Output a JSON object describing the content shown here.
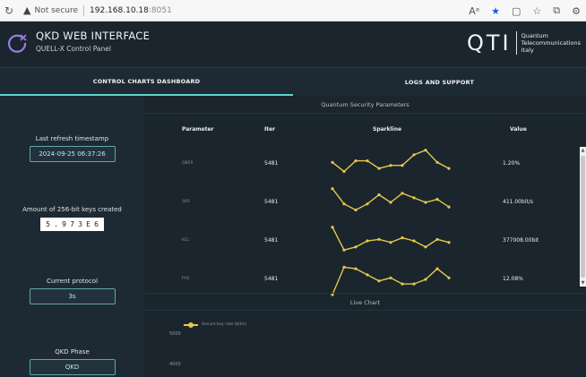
{
  "browser": {
    "reload_icon": "reload-icon",
    "warning_icon": "warning-icon",
    "security_label": "Not secure",
    "url": "192.168.10.18",
    "url_port": ":8051",
    "toolbar_icons": [
      "read-aloud-icon",
      "favorite-star-icon",
      "split-screen-icon",
      "favorites-icon",
      "collections-icon",
      "extensions-icon"
    ]
  },
  "header": {
    "title": "QKD WEB INTERFACE",
    "subtitle": "QUELL-X Control Panel",
    "logo_icon": "qkd-logo-icon",
    "brand_mark": "QTI",
    "brand_line1": "Quantum",
    "brand_line2": "Telecommunications",
    "brand_line3": "Italy"
  },
  "tabs": [
    {
      "label": "CONTROL CHARTS DASHBOARD",
      "active": true
    },
    {
      "label": "LOGS AND SUPPORT",
      "active": false
    }
  ],
  "sidebar": {
    "refresh_label": "Last refresh timestamp",
    "refresh_value": "2024-09-25 06:37:26",
    "keys_label": "Amount of 256-bit keys created",
    "keys_digits": [
      "5",
      ".",
      "9",
      "7",
      "3",
      "E",
      "6"
    ],
    "protocol_label": "Current protocol",
    "protocol_value": "3s",
    "phase_label": "QKD Phase",
    "phase_value": "QKD"
  },
  "security_params": {
    "title": "Quantum Security Parameters",
    "headers": {
      "parameter": "Parameter",
      "iter": "Iter",
      "sparkline": "Sparkline",
      "value": "Value"
    },
    "rows": [
      {
        "parameter": "QBER",
        "iter": "5481",
        "value": "1.20%",
        "spark": [
          0.55,
          0.25,
          0.6,
          0.6,
          0.35,
          0.45,
          0.45,
          0.8,
          0.95,
          0.55,
          0.35
        ]
      },
      {
        "parameter": "SKR",
        "iter": "5481",
        "value": "411.00bit/s",
        "spark": [
          0.95,
          0.45,
          0.25,
          0.45,
          0.75,
          0.5,
          0.8,
          0.65,
          0.5,
          0.6,
          0.35
        ]
      },
      {
        "parameter": "KEL",
        "iter": "5481",
        "value": "377008.00bit",
        "spark": [
          0.95,
          0.2,
          0.3,
          0.5,
          0.55,
          0.45,
          0.6,
          0.5,
          0.3,
          0.55,
          0.45
        ]
      },
      {
        "parameter": "PHE",
        "iter": "5481",
        "value": "12.08%",
        "spark": [
          0.0,
          0.9,
          0.85,
          0.65,
          0.45,
          0.55,
          0.35,
          0.35,
          0.5,
          0.85,
          0.55
        ]
      }
    ]
  },
  "live_chart": {
    "title": "Live Chart",
    "legend": "Secure key rate (bit/s)",
    "yticks": [
      "5000",
      "4000"
    ],
    "line_color": "#e6c84a"
  },
  "colors": {
    "accent": "#5fd3d0",
    "spark": "#e6c84a"
  }
}
